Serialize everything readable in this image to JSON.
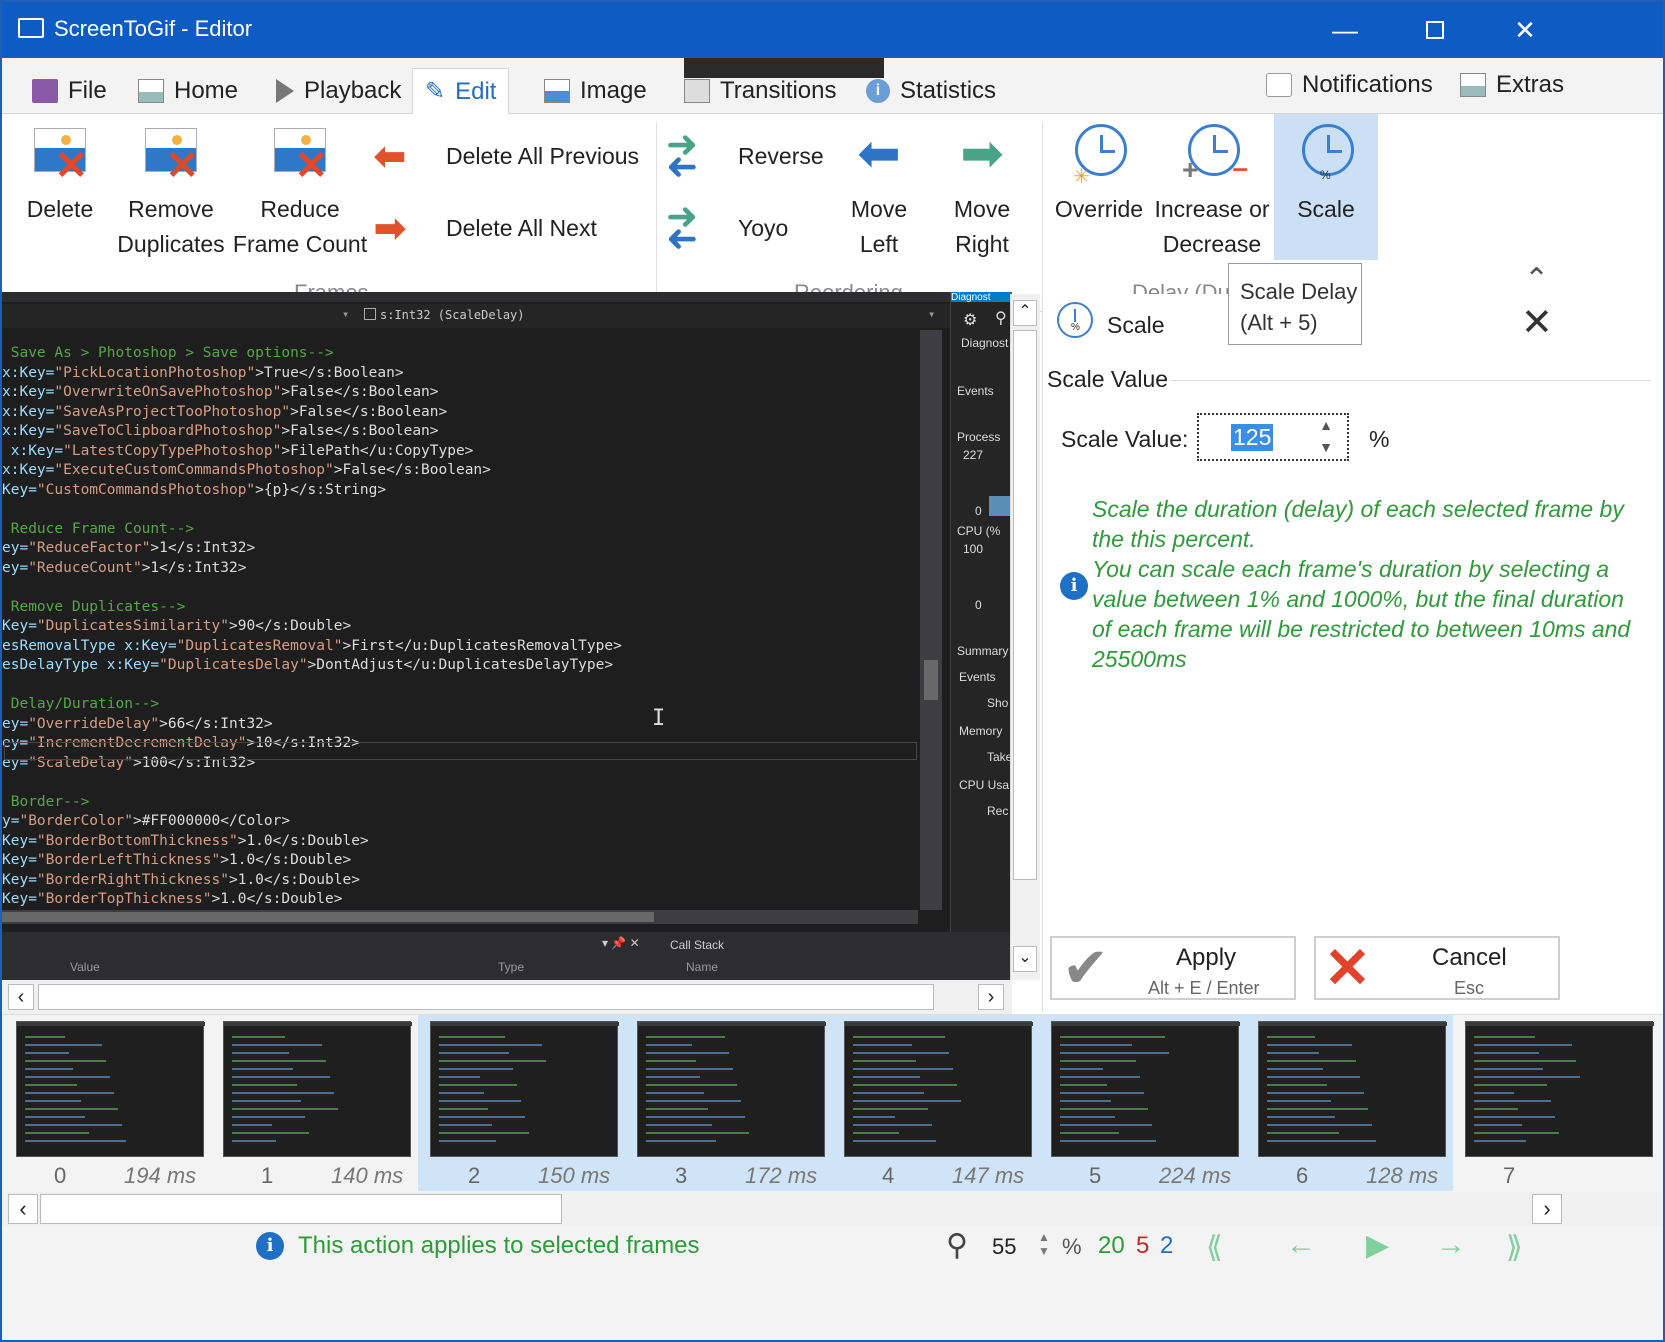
{
  "window": {
    "title": "ScreenToGif - Editor"
  },
  "tabs": [
    {
      "label": "File",
      "icon": "save-icon"
    },
    {
      "label": "Home",
      "icon": "home-image-icon"
    },
    {
      "label": "Playback",
      "icon": "play-icon"
    },
    {
      "label": "Edit",
      "icon": "pencil-icon"
    },
    {
      "label": "Image",
      "icon": "image-icon"
    },
    {
      "label": "Transitions",
      "icon": "transitions-icon"
    },
    {
      "label": "Statistics",
      "icon": "info-icon"
    }
  ],
  "top_right": {
    "notifications": "Notifications",
    "extras": "Extras"
  },
  "ribbon": {
    "frames": {
      "delete": "Delete",
      "remove_dup_1": "Remove",
      "remove_dup_2": "Duplicates",
      "reduce_1": "Reduce",
      "reduce_2": "Frame Count",
      "delete_all_previous": "Delete All Previous",
      "delete_all_next": "Delete All Next",
      "group": "Frames"
    },
    "reordering": {
      "reverse": "Reverse",
      "yoyo": "Yoyo",
      "move_left_1": "Move",
      "move_left_2": "Left",
      "move_right_1": "Move",
      "move_right_2": "Right",
      "group": "Reordering"
    },
    "delay": {
      "override": "Override",
      "increase_1": "Increase or",
      "increase_2": "Decrease",
      "scale": "Scale",
      "group": "Delay (Du"
    }
  },
  "tooltip": {
    "line1": "Scale Delay",
    "line2": "(Alt + 5)"
  },
  "code": {
    "nav": "s:Int32 (ScaleDelay)",
    "lines": [
      {
        "c": "cm",
        "t": " Save As > Photoshop > Save options-->"
      },
      {
        "c": "mix",
        "a": "x:Key=",
        "s": "\"PickLocationPhotoshop\"",
        "r": ">True</s:Boolean>"
      },
      {
        "c": "mix",
        "a": "x:Key=",
        "s": "\"OverwriteOnSavePhotoshop\"",
        "r": ">False</s:Boolean>"
      },
      {
        "c": "mix",
        "a": "x:Key=",
        "s": "\"SaveAsProjectTooPhotoshop\"",
        "r": ">False</s:Boolean>"
      },
      {
        "c": "mix",
        "a": "x:Key=",
        "s": "\"SaveToClipboardPhotoshop\"",
        "r": ">False</s:Boolean>"
      },
      {
        "c": "mix",
        "a": " x:Key=",
        "s": "\"LatestCopyTypePhotoshop\"",
        "r": ">FilePath</u:CopyType>"
      },
      {
        "c": "mix",
        "a": "x:Key=",
        "s": "\"ExecuteCustomCommandsPhotoshop\"",
        "r": ">False</s:Boolean>"
      },
      {
        "c": "mix",
        "a": "Key=",
        "s": "\"CustomCommandsPhotoshop\"",
        "r": ">{p}</s:String>"
      },
      {
        "c": "blank",
        "t": ""
      },
      {
        "c": "cm",
        "t": " Reduce Frame Count-->"
      },
      {
        "c": "mix",
        "a": "ey=",
        "s": "\"ReduceFactor\"",
        "r": ">1</s:Int32>"
      },
      {
        "c": "mix",
        "a": "ey=",
        "s": "\"ReduceCount\"",
        "r": ">1</s:Int32>"
      },
      {
        "c": "blank",
        "t": ""
      },
      {
        "c": "cm",
        "t": " Remove Duplicates-->"
      },
      {
        "c": "mix",
        "a": "Key=",
        "s": "\"DuplicatesSimilarity\"",
        "r": ">90</s:Double>"
      },
      {
        "c": "mix",
        "a": "esRemovalType x:Key=",
        "s": "\"DuplicatesRemoval\"",
        "r": ">First</u:DuplicatesRemovalType>"
      },
      {
        "c": "mix",
        "a": "esDelayType x:Key=",
        "s": "\"DuplicatesDelay\"",
        "r": ">DontAdjust</u:DuplicatesDelayType>"
      },
      {
        "c": "blank",
        "t": ""
      },
      {
        "c": "cm",
        "t": " Delay/Duration-->"
      },
      {
        "c": "mix",
        "a": "ey=",
        "s": "\"OverrideDelay\"",
        "r": ">66</s:Int32>"
      },
      {
        "c": "mix",
        "a": "ey=",
        "s": "\"IncrementDecrementDelay\"",
        "r": ">10</s:Int32>"
      },
      {
        "c": "mix",
        "a": "ey=",
        "s": "\"ScaleDelay\"",
        "r": ">100</s:Int32>"
      },
      {
        "c": "blank",
        "t": ""
      },
      {
        "c": "cm",
        "t": " Border-->"
      },
      {
        "c": "mix",
        "a": "y=",
        "s": "\"BorderColor\"",
        "r": ">#FF000000</Color>"
      },
      {
        "c": "mix",
        "a": "Key=",
        "s": "\"BorderBottomThickness\"",
        "r": ">1.0</s:Double>"
      },
      {
        "c": "mix",
        "a": "Key=",
        "s": "\"BorderLeftThickness\"",
        "r": ">1.0</s:Double>"
      },
      {
        "c": "mix",
        "a": "Key=",
        "s": "\"BorderRightThickness\"",
        "r": ">1.0</s:Double>"
      },
      {
        "c": "mix",
        "a": "Key=",
        "s": "\"BorderTopThickness\"",
        "r": ">1.0</s:Double>"
      }
    ]
  },
  "diagnostics": {
    "title": "Diagnost",
    "events": "Events",
    "process": "Process",
    "p227": "227",
    "p0": "0",
    "cpu": "CPU (%",
    "c100": "100",
    "c0": "0",
    "summary": "Summary",
    "events2": "Events",
    "show": "Sho",
    "memory": "Memory",
    "take": "Take",
    "cpu_usage": "CPU Usa",
    "rec": "Rec"
  },
  "bottom_panel": {
    "value": "Value",
    "type": "Type",
    "call_stack": "Call Stack",
    "name": "Name"
  },
  "panel": {
    "title": "Scale",
    "section": "Scale Value",
    "label": "Scale Value:",
    "value": "125",
    "unit": "%",
    "help1": "Scale the duration (delay) of each selected frame by the this percent.",
    "help2": "You can scale each frame's duration by selecting a value between 1% and 1000%, but the final duration of each frame will be restricted to between 10ms and 25500ms",
    "apply": "Apply",
    "apply_shortcut": "Alt + E / Enter",
    "cancel": "Cancel",
    "cancel_shortcut": "Esc"
  },
  "frames": [
    {
      "n": "0",
      "ms": "194 ms",
      "sel": false
    },
    {
      "n": "1",
      "ms": "140 ms",
      "sel": false
    },
    {
      "n": "2",
      "ms": "150 ms",
      "sel": true
    },
    {
      "n": "3",
      "ms": "172 ms",
      "sel": true
    },
    {
      "n": "4",
      "ms": "147 ms",
      "sel": true
    },
    {
      "n": "5",
      "ms": "224 ms",
      "sel": true
    },
    {
      "n": "6",
      "ms": "128 ms",
      "sel": true
    },
    {
      "n": "7",
      "ms": "",
      "sel": false
    }
  ],
  "status": {
    "message": "This action applies to selected frames",
    "zoom": "55",
    "zoom_unit": "%",
    "total": "20",
    "selected": "5",
    "current": "2",
    "colors": {
      "total": "#2e9a3a",
      "selected": "#c62828",
      "current": "#1f6fc5"
    }
  }
}
